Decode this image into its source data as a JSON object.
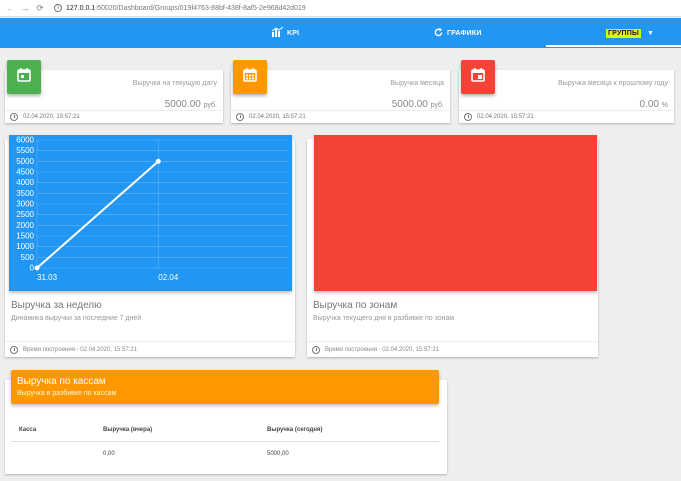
{
  "browser": {
    "url_host": "127.0.0.1",
    "url_path": ":60020/Dashboard/Groups/019f4763-88bf-438f-8af5-2e968d42d019"
  },
  "nav": {
    "kpi": "KPI",
    "charts": "ГРАФИКИ",
    "groups": "ГРУППЫ"
  },
  "kpis": [
    {
      "title": "Выручка на текущую дату",
      "value": "5000.00",
      "unit": "руб.",
      "timestamp": "02.04.2020, 15:57:21",
      "color": "#4caf50",
      "icon": "calendar-today-icon"
    },
    {
      "title": "Выручка месяца",
      "value": "5000.00",
      "unit": "руб.",
      "timestamp": "02.04.2020, 15:57:21",
      "color": "#ff9800",
      "icon": "calendar-month-icon"
    },
    {
      "title": "Выручка месяца к прошлому году",
      "value": "0.00",
      "unit": "%",
      "timestamp": "02.04.2020, 15:57:21",
      "color": "#f44336",
      "icon": "calendar-compare-icon"
    }
  ],
  "weekly": {
    "title": "Выручка за неделю",
    "subtitle": "Динамика выручки за последние 7 дней",
    "footer": "Время построения - 02.04.2020, 15:57:21",
    "color": "#2196f3"
  },
  "zones": {
    "title": "Выручка по зонам",
    "subtitle": "Выручка текущего дня в разбивке по зонам",
    "footer": "Время построения - 02.04.2020, 15:57:21",
    "color": "#f44336"
  },
  "chart_data": {
    "type": "line",
    "x": [
      "31.03",
      "02.04"
    ],
    "series": [
      {
        "values": [
          0,
          5000
        ]
      }
    ],
    "yticks": [
      0,
      500,
      1000,
      1500,
      2000,
      2500,
      3000,
      3500,
      4000,
      4500,
      5000,
      5500,
      6000
    ],
    "ylim": [
      0,
      6000
    ],
    "grid": true
  },
  "cash": {
    "title": "Выручка по кассам",
    "subtitle": "Выручка в разбивке по кассам",
    "columns": [
      "Касса",
      "Выручка (вчера)",
      "Выручка (сегодня)"
    ],
    "rows": [
      [
        "",
        "0,00",
        "5000,00"
      ]
    ]
  }
}
